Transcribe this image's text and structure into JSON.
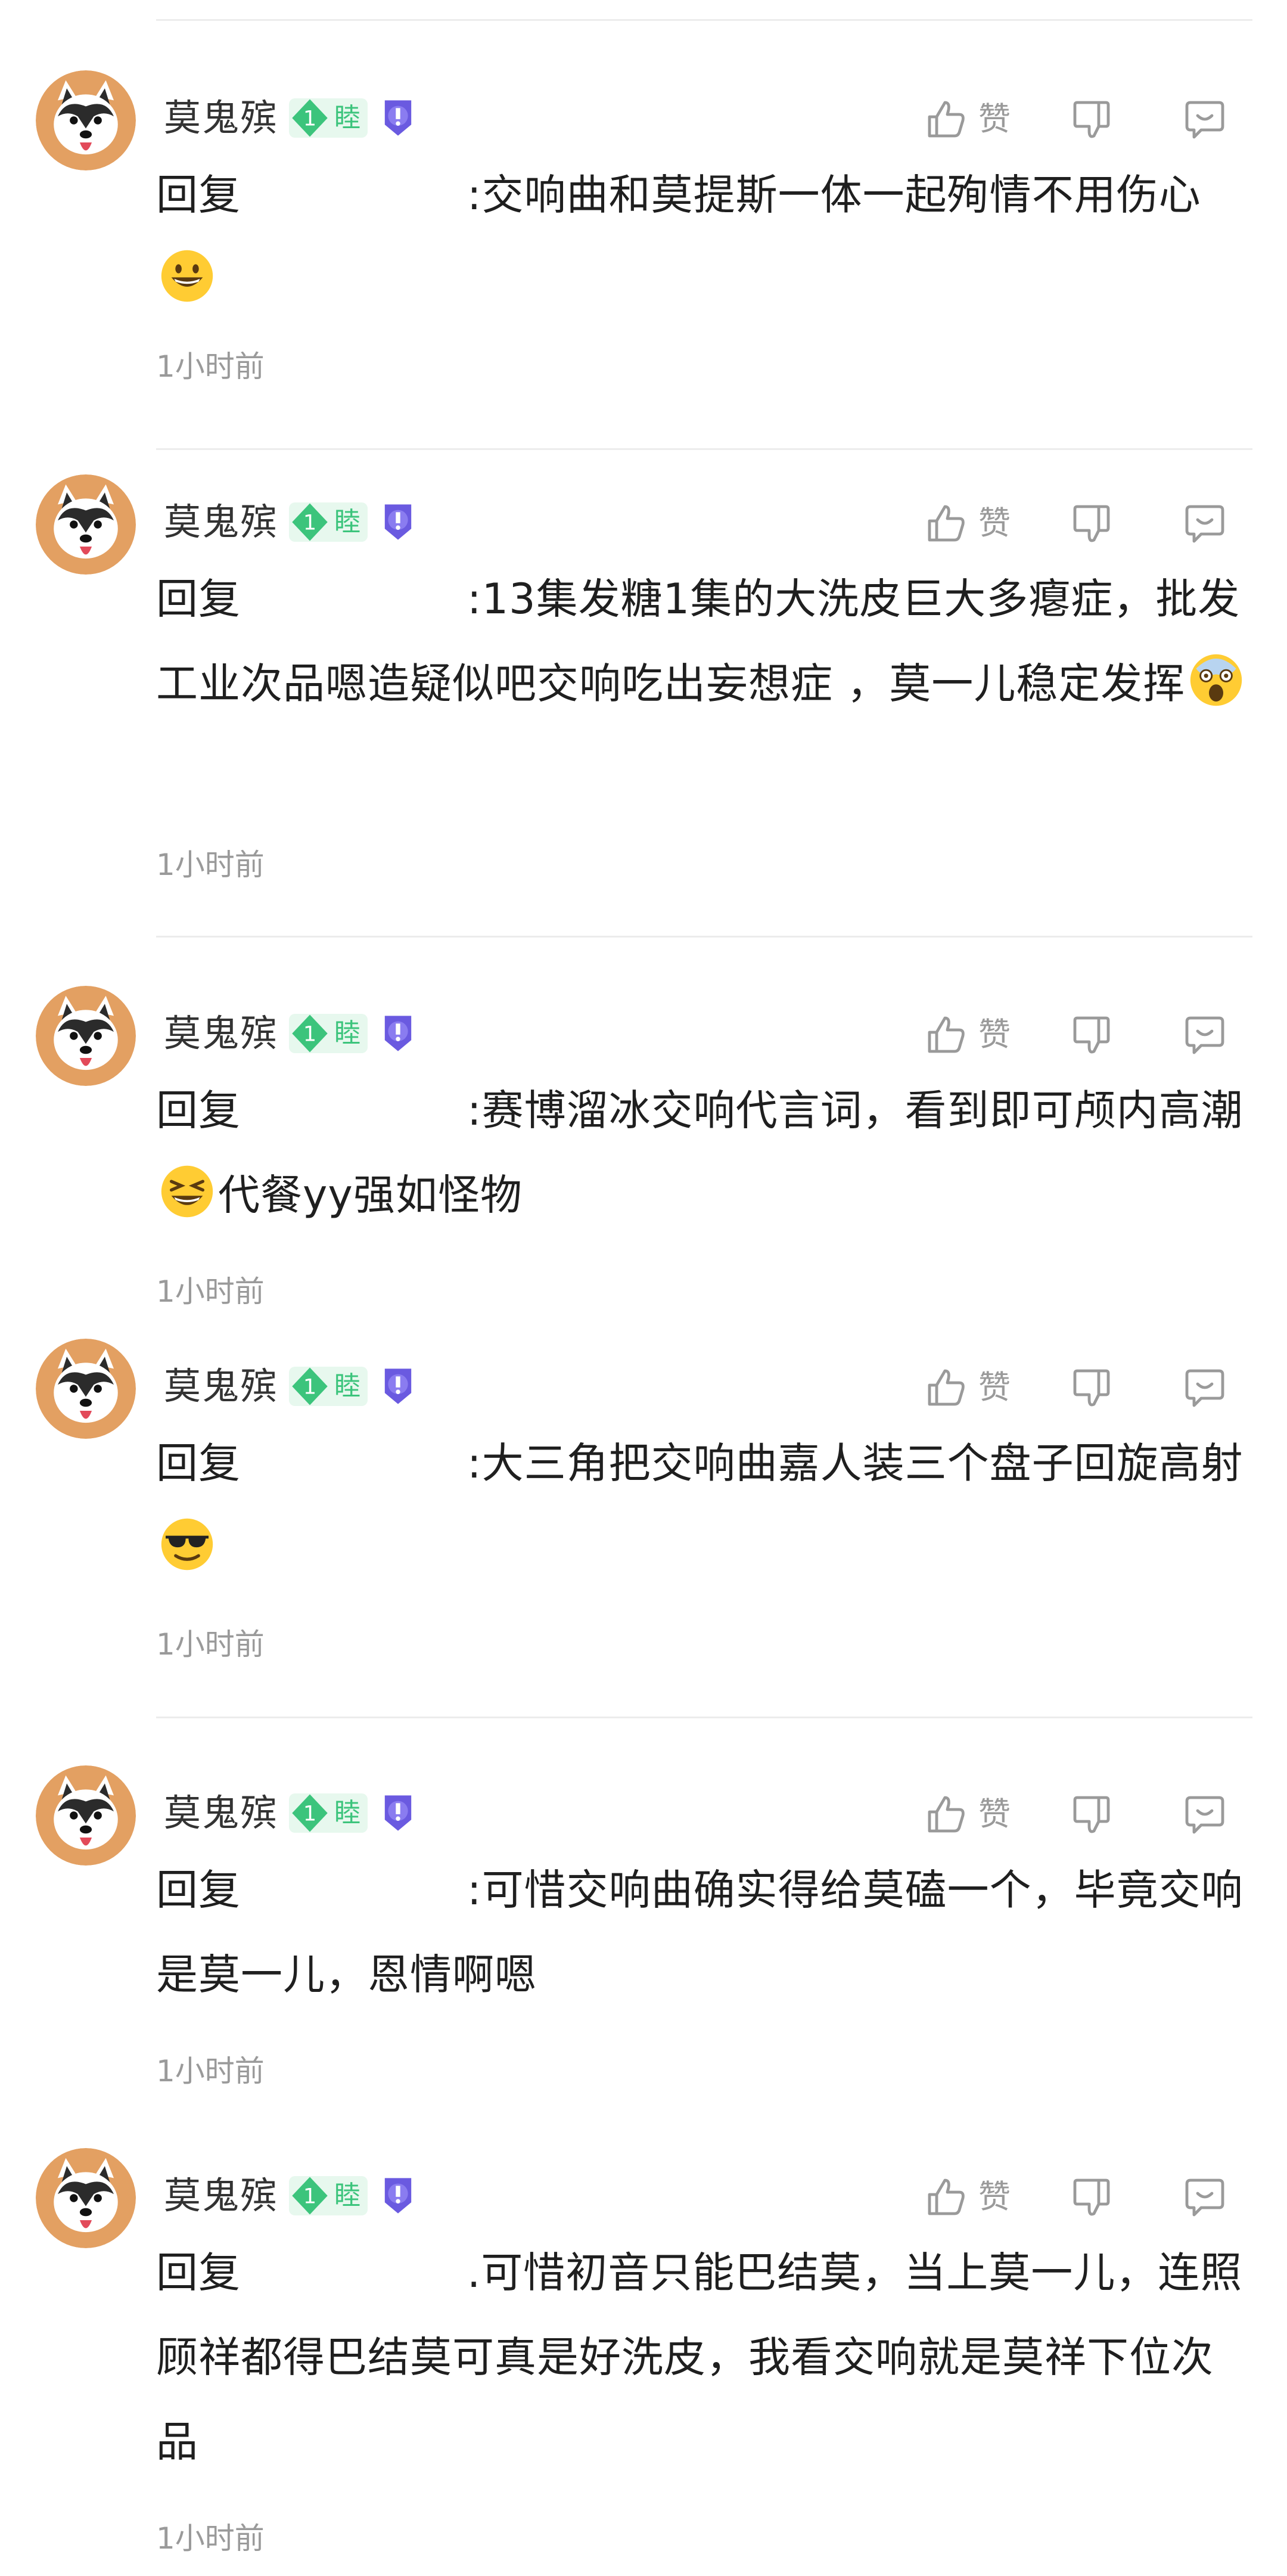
{
  "comments": [
    {
      "username": "莫鬼殡",
      "level": "1",
      "badge": "睦",
      "like_label": "赞",
      "reply_prefix": "回复",
      "text_1": ":交响曲和莫提斯一体一起殉情不用伤心",
      "emoji_1": "grinning-face-emoji",
      "text_2": "",
      "time": "1小时前"
    },
    {
      "username": "莫鬼殡",
      "level": "1",
      "badge": "睦",
      "like_label": "赞",
      "reply_prefix": "回复",
      "text_1": ":13集发糖1集的大洗皮巨大多瘪症，批发工业次品嗯造疑似吧交响吃出妄想症 ，莫一儿稳定发挥",
      "emoji_1": "screaming-face-emoji",
      "text_2": "",
      "time": "1小时前"
    },
    {
      "username": "莫鬼殡",
      "level": "1",
      "badge": "睦",
      "like_label": "赞",
      "reply_prefix": "回复",
      "text_1": ":赛博溜冰交响代言词，看到即可颅内高潮",
      "emoji_1": "grinning-squint-emoji",
      "text_2": "代餐yy强如怪物",
      "time": "1小时前"
    },
    {
      "username": "莫鬼殡",
      "level": "1",
      "badge": "睦",
      "like_label": "赞",
      "reply_prefix": "回复",
      "text_1": ":大三角把交响曲嘉人装三个盘子回旋高射",
      "emoji_1": "sunglasses-face-emoji",
      "text_2": "",
      "time": "1小时前"
    },
    {
      "username": "莫鬼殡",
      "level": "1",
      "badge": "睦",
      "like_label": "赞",
      "reply_prefix": "回复",
      "text_1": ":可惜交响曲确实得给莫磕一个，毕竟交响是莫一儿，恩情啊嗯",
      "emoji_1": "",
      "text_2": "",
      "time": "1小时前"
    },
    {
      "username": "莫鬼殡",
      "level": "1",
      "badge": "睦",
      "like_label": "赞",
      "reply_prefix": "回复",
      "text_1": ".可惜初音只能巴结莫，当上莫一儿，连照顾祥都得巴结莫可真是好洗皮，我看交响就是莫祥下位次品",
      "emoji_1": "",
      "text_2": "",
      "time": "1小时前"
    }
  ],
  "colors": {
    "level_green": "#3cc47c",
    "badge_bg": "#e7f8ee",
    "icon_gray": "#9a9a9a",
    "medal_purple": "#6a5ae0",
    "divider": "#ececec"
  }
}
